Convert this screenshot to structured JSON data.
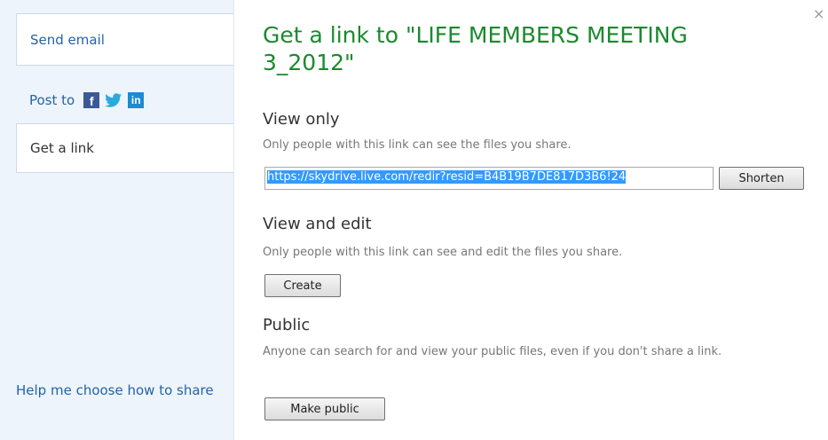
{
  "sidebar": {
    "send_email": "Send email",
    "post_to": "Post to",
    "social_icons": [
      "facebook-icon",
      "twitter-icon",
      "linkedin-icon"
    ],
    "get_a_link": "Get a link",
    "help": "Help me choose how to share"
  },
  "dialog": {
    "title": "Get a link to \"LIFE MEMBERS MEETING 3_2012\"",
    "close_icon": "×",
    "view_only": {
      "heading": "View only",
      "description": "Only people with this link can see the files you share.",
      "link_value": "https://skydrive.live.com/redir?resid=B4B19B7DE817D3B6!24",
      "shorten_label": "Shorten"
    },
    "view_and_edit": {
      "heading": "View and edit",
      "description": "Only people with this link can see and edit the files you share.",
      "create_label": "Create"
    },
    "public": {
      "heading": "Public",
      "description": "Anyone can search for and view your public files, even if you don't share a link.",
      "make_public_label": "Make public"
    }
  },
  "colors": {
    "link": "#2363a8",
    "title": "#1a8a2e",
    "sidebar_bg": "#eef4fb",
    "selection": "#3399ff"
  }
}
